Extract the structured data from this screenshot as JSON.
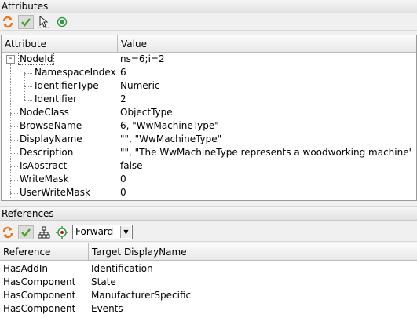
{
  "attributes_panel": {
    "title": "Attributes",
    "columns": {
      "attribute": "Attribute",
      "value": "Value"
    },
    "expander_symbol": "-",
    "rows": [
      {
        "name": "NodeId",
        "value": "ns=6;i=2"
      },
      {
        "name": "NamespaceIndex",
        "value": "6"
      },
      {
        "name": "IdentifierType",
        "value": "Numeric"
      },
      {
        "name": "Identifier",
        "value": "2"
      },
      {
        "name": "NodeClass",
        "value": "ObjectType"
      },
      {
        "name": "BrowseName",
        "value": "6, \"WwMachineType\""
      },
      {
        "name": "DisplayName",
        "value": "\"\", \"WwMachineType\""
      },
      {
        "name": "Description",
        "value": "\"\", \"The WwMachineType represents a woodworking machine\""
      },
      {
        "name": "IsAbstract",
        "value": "false"
      },
      {
        "name": "WriteMask",
        "value": "0"
      },
      {
        "name": "UserWriteMask",
        "value": "0"
      }
    ]
  },
  "references_panel": {
    "title": "References",
    "direction": "Forward",
    "columns": {
      "reference": "Reference",
      "target": "Target DisplayName"
    },
    "rows": [
      {
        "reference": "HasAddIn",
        "target": "Identification"
      },
      {
        "reference": "HasComponent",
        "target": "State"
      },
      {
        "reference": "HasComponent",
        "target": "ManufacturerSpecific"
      },
      {
        "reference": "HasComponent",
        "target": "Events"
      }
    ]
  },
  "icons": {
    "refresh": "refresh-icon",
    "apply": "checkmark-icon",
    "cursor": "pointer-icon",
    "radio": "target-icon",
    "tree": "hierarchy-icon",
    "bullseye": "compass-icon"
  },
  "colors": {
    "refresh_orange": "#e8761e",
    "check_green": "#4ca32b",
    "radio_green": "#2e9a3c"
  }
}
